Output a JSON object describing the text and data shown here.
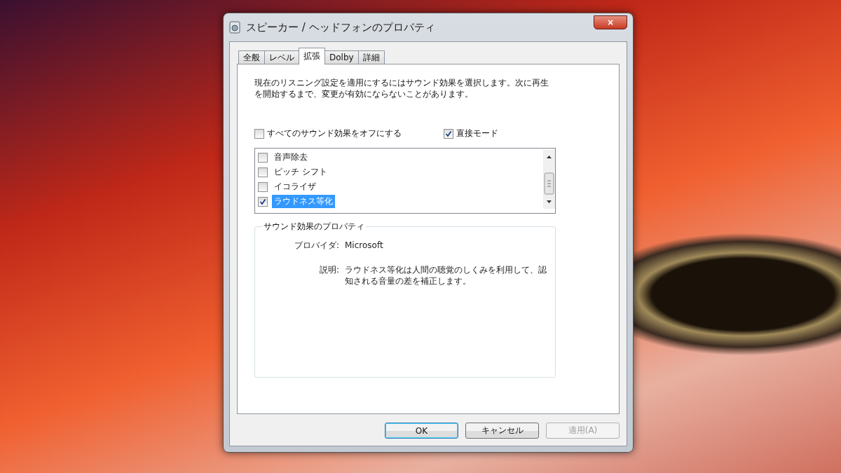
{
  "window": {
    "title": "スピーカー / ヘッドフォンのプロパティ",
    "close": "×"
  },
  "tabs": [
    {
      "label": "全般",
      "selected": false
    },
    {
      "label": "レベル",
      "selected": false
    },
    {
      "label": "拡張",
      "selected": true
    },
    {
      "label": "Dolby",
      "selected": false
    },
    {
      "label": "詳細",
      "selected": false
    }
  ],
  "intro": "現在のリスニング設定を適用にするにはサウンド効果を選択します。次に再生を開始するまで、変更が有効にならないことがあります。",
  "options": [
    {
      "label": "すべてのサウンド効果をオフにする",
      "checked": false
    },
    {
      "label": "直接モード",
      "checked": true
    }
  ],
  "effects": [
    {
      "label": "音声除去",
      "checked": false,
      "selected": false
    },
    {
      "label": "ピッチ シフト",
      "checked": false,
      "selected": false
    },
    {
      "label": "イコライザ",
      "checked": false,
      "selected": false
    },
    {
      "label": "ラウドネス等化",
      "checked": true,
      "selected": true
    }
  ],
  "properties": {
    "title": "サウンド効果のプロパティ",
    "rows": [
      {
        "label": "プロバイダ:",
        "value": "Microsoft"
      },
      {
        "label": "説明:",
        "value": "ラウドネス等化は人間の聴覚のしくみを利用して、認知される音量の差を補正します。"
      }
    ]
  },
  "buttons": [
    {
      "label": "OK",
      "kind": "default",
      "disabled": false
    },
    {
      "label": "キャンセル",
      "kind": "normal",
      "disabled": false
    },
    {
      "label": "適用(A)",
      "kind": "normal",
      "disabled": true
    }
  ]
}
